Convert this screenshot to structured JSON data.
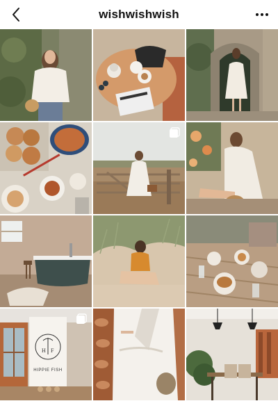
{
  "header": {
    "title": "wishwishwish",
    "back_icon": "chevron-left-icon",
    "more_icon": "more-horizontal-icon"
  },
  "grid": {
    "posts": [
      {
        "id": 1,
        "subject": "woman in white blouse in garden",
        "multi": false
      },
      {
        "id": 2,
        "subject": "cafe table with teapot and newspaper",
        "multi": false
      },
      {
        "id": 3,
        "subject": "woman in white dress by stone archway",
        "multi": false
      },
      {
        "id": 4,
        "subject": "pastries and tea flatlay",
        "multi": false
      },
      {
        "id": 5,
        "subject": "woman at farm gate in field",
        "multi": true
      },
      {
        "id": 6,
        "subject": "woman sitting with basket",
        "multi": false
      },
      {
        "id": 7,
        "subject": "bathroom with clawfoot bathtub",
        "multi": false
      },
      {
        "id": 8,
        "subject": "woman sitting in sand dunes",
        "multi": false
      },
      {
        "id": 9,
        "subject": "food on rustic wooden table",
        "multi": false
      },
      {
        "id": 10,
        "subject": "hippie fish shop sign",
        "multi": true,
        "sign_text": "HIPPIE FISH"
      },
      {
        "id": 11,
        "subject": "woman in white wrap dress",
        "multi": false
      },
      {
        "id": 12,
        "subject": "restaurant interior with plants",
        "multi": false
      }
    ]
  },
  "colors": {
    "background": "#ffffff",
    "text": "#111111"
  }
}
